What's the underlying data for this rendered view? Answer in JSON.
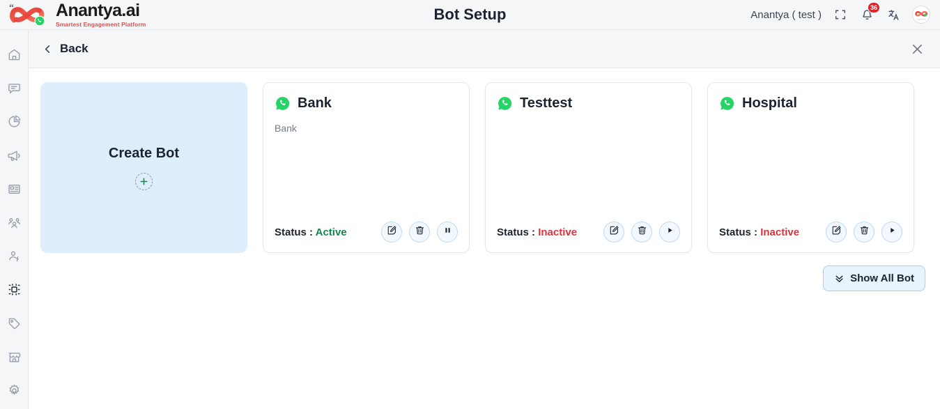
{
  "header": {
    "brand_name": "Anantya.ai",
    "brand_tagline": "Smartest Engagement Platform",
    "title": "Bot Setup",
    "account_name": "Anantya ( test )",
    "icons": {
      "fullscreen": "fullscreen-icon",
      "notifications": "bell-icon",
      "translate": "translate-icon",
      "avatar": "avatar"
    },
    "notification_count": "36"
  },
  "sidebar": {
    "items": [
      {
        "name": "home",
        "icon": "home-icon",
        "active": false
      },
      {
        "name": "chats",
        "icon": "chat-bubble-icon",
        "active": false
      },
      {
        "name": "analytics",
        "icon": "pie-chart-icon",
        "active": false
      },
      {
        "name": "campaigns",
        "icon": "megaphone-icon",
        "active": false
      },
      {
        "name": "templates",
        "icon": "layout-list-icon",
        "active": false
      },
      {
        "name": "contacts",
        "icon": "users-group-icon",
        "active": false
      },
      {
        "name": "agents",
        "icon": "user-bolt-icon",
        "active": false
      },
      {
        "name": "bot-setup",
        "icon": "bot-frame-icon",
        "active": true
      },
      {
        "name": "tags",
        "icon": "tag-icon",
        "active": false
      },
      {
        "name": "catalog",
        "icon": "store-icon",
        "active": false
      },
      {
        "name": "settings",
        "icon": "gear-icon",
        "active": false
      }
    ]
  },
  "subbar": {
    "back_label": "Back",
    "back_icon": "chevron-left-icon",
    "close_icon": "close-icon"
  },
  "create_card": {
    "title": "Create Bot",
    "plus_icon": "plus-icon"
  },
  "bots": [
    {
      "name": "Bank",
      "description": "Bank",
      "channel_icon": "whatsapp-icon",
      "status_label": "Status : ",
      "status_value": "Active",
      "status_state": "active",
      "actions": [
        {
          "name": "edit-bot-button",
          "icon": "edit-icon"
        },
        {
          "name": "delete-bot-button",
          "icon": "trash-icon"
        },
        {
          "name": "pause-bot-button",
          "icon": "pause-icon"
        }
      ]
    },
    {
      "name": "Testtest",
      "description": "",
      "channel_icon": "whatsapp-icon",
      "status_label": "Status : ",
      "status_value": "Inactive",
      "status_state": "inactive",
      "actions": [
        {
          "name": "edit-bot-button",
          "icon": "edit-icon"
        },
        {
          "name": "delete-bot-button",
          "icon": "trash-icon"
        },
        {
          "name": "play-bot-button",
          "icon": "play-icon"
        }
      ]
    },
    {
      "name": "Hospital",
      "description": "",
      "channel_icon": "whatsapp-icon",
      "status_label": "Status : ",
      "status_value": "Inactive",
      "status_state": "inactive",
      "actions": [
        {
          "name": "edit-bot-button",
          "icon": "edit-icon"
        },
        {
          "name": "delete-bot-button",
          "icon": "trash-icon"
        },
        {
          "name": "play-bot-button",
          "icon": "play-icon"
        }
      ]
    }
  ],
  "show_all": {
    "label": "Show All Bot",
    "icon": "double-chevron-down-icon"
  },
  "colors": {
    "header_bg": "#f5f6f8",
    "create_card_bg": "#dfeefc",
    "status_active": "#13854e",
    "status_inactive": "#d9343c",
    "badge_red": "#e0242b",
    "whatsapp_green": "#25d366",
    "action_border": "#bcdcf5"
  }
}
